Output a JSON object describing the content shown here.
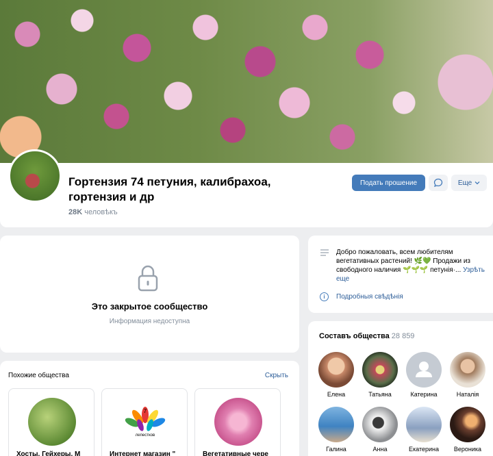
{
  "group": {
    "title": "Гортензия 74 петуния, калибрахоа, гортензия и др",
    "members_count": "28K",
    "members_label": "человѣкъ"
  },
  "actions": {
    "request_label": "Подать прошение",
    "more_label": "Еще"
  },
  "closed": {
    "title": "Это закрытое сообщество",
    "subtitle": "Информация недоступна"
  },
  "similar": {
    "title": "Похожие общества",
    "hide_label": "Скрыть",
    "items": [
      {
        "name": "Хосты, Гейхеры, М"
      },
      {
        "name": "Интернет магазин \""
      },
      {
        "name": "Вегетативные чере"
      }
    ],
    "logo_number": "7",
    "logo_text": "лепестков"
  },
  "info": {
    "description": "Добро пожаловать, всем любителям вегетативных растений! 🌿💚 Продажи из свободного наличия 🌱🌱🌱 петунія·...",
    "more_link": "Узрѣть еще",
    "details_label": "Подробныя свѣдѣнія"
  },
  "members": {
    "title": "Составъ общества",
    "count": "28 859",
    "list": [
      {
        "name": "Елена",
        "color": "#c98a6a"
      },
      {
        "name": "Татьяна",
        "color": "#5a6e4a"
      },
      {
        "name": "Катерина",
        "color": "#c5cbd3"
      },
      {
        "name": "Наталія",
        "color": "#a07a5c"
      },
      {
        "name": "Галина",
        "color": "#3f83c2"
      },
      {
        "name": "Анна",
        "color": "#8d8f92"
      },
      {
        "name": "Екатерина",
        "color": "#8aa0c0"
      },
      {
        "name": "Вероника",
        "color": "#6a3e2e"
      }
    ]
  }
}
